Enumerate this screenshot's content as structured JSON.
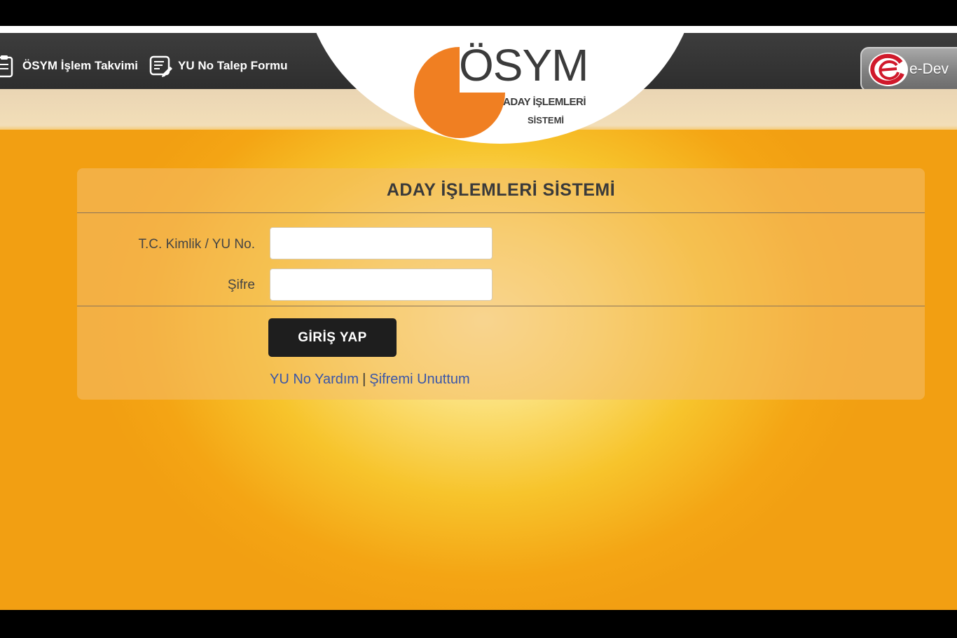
{
  "nav": {
    "takvim_label": "ÖSYM İşlem Takvimi",
    "yuno_form_label": "YU No Talep Formu",
    "edevlet_label": "e-Dev"
  },
  "logo": {
    "word": "ÖSYM",
    "sub1": "ADAY İŞLEMLERİ",
    "sub2": "SİSTEMİ",
    "orange": "#f07f22"
  },
  "login": {
    "title": "ADAY İŞLEMLERİ SİSTEMİ",
    "tc_label": "T.C. Kimlik / YU No.",
    "tc_value": "",
    "password_label": "Şifre",
    "password_value": "",
    "submit_label": "GİRİŞ YAP",
    "help_link": "YU No Yardım",
    "separator": "|",
    "forgot_link": "Şifremi Unuttum"
  },
  "colors": {
    "navbar": "#333333",
    "link": "#3a56a8",
    "button": "#1e1e1e",
    "background": "#f4a514"
  }
}
